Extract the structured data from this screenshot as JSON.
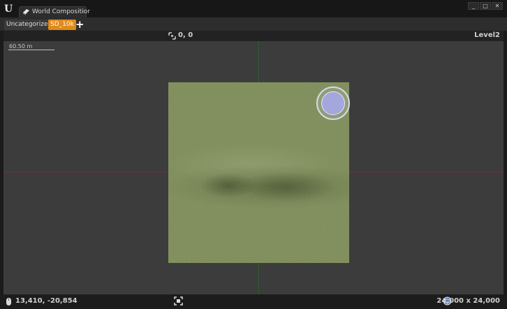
{
  "window": {
    "tab_title": "World Compositior",
    "tab_close": "×",
    "buttons": {
      "minimize": "_",
      "maximize": "□",
      "close": "✕"
    }
  },
  "toolbar": {
    "layers": [
      "Uncategorized",
      "SD_10k"
    ],
    "add_label": "+"
  },
  "viewport": {
    "origin": "0, 0",
    "level": "Level2",
    "scale_label": "60.50 m"
  },
  "status": {
    "mouse_coords": "13,410, -20,854",
    "world_size": "24,000 x 24,000"
  },
  "icons": [
    "unreal-logo-icon",
    "world-composition-icon",
    "origin-icon",
    "mouse-icon",
    "focus-icon",
    "globe-icon"
  ],
  "colors": {
    "accent": "#e08a1a",
    "tile": "#7a8a52",
    "handle": "#a3a7dc"
  }
}
